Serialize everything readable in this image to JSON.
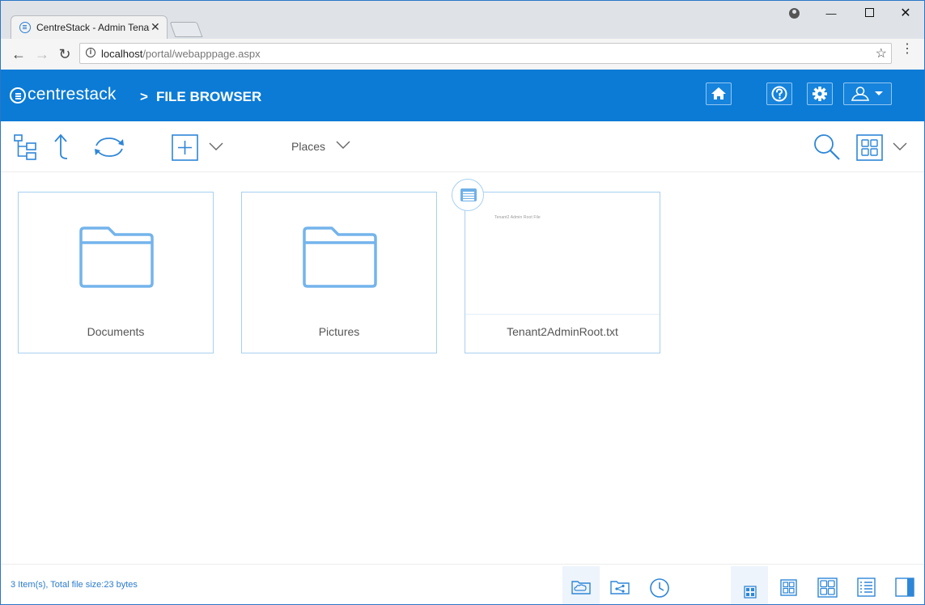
{
  "browser": {
    "tab_title": "CentreStack - Admin Tenant",
    "tab_close": "✕",
    "url_host": "localhost",
    "url_path": "/portal/webapppage.aspx",
    "info_glyph": "i",
    "star_glyph": "☆",
    "menu_glyph": "⋮",
    "back_glyph": "←",
    "forward_glyph": "→",
    "reload_glyph": "↻",
    "minimize_glyph": "—",
    "close_glyph": "✕"
  },
  "header": {
    "logo_text_light": "centre",
    "logo_text_bold": "stack",
    "breadcrumb_sep": ">",
    "breadcrumb_title": "FILE BROWSER",
    "icons": [
      "home-icon",
      "help-icon",
      "gear-icon",
      "user-icon",
      "caret-down-icon"
    ]
  },
  "toolbar": {
    "places_label": "Places",
    "icons": [
      "folder-tree-icon",
      "up-arrow-icon",
      "sync-icon",
      "add-icon",
      "chevron-down-icon",
      "search-icon",
      "grid-view-icon",
      "chevron-down-icon"
    ]
  },
  "files": [
    {
      "name": "Documents",
      "type": "folder"
    },
    {
      "name": "Pictures",
      "type": "folder"
    },
    {
      "name": "Tenant2AdminRoot.txt",
      "type": "file",
      "preview_text": "Tenant2 Admin Root File"
    }
  ],
  "status": {
    "summary": "3 Item(s), Total file size:23 bytes"
  },
  "statusbar_icons": [
    "cloud-folder-icon",
    "shared-folder-icon",
    "clock-icon",
    "small-tiles-icon",
    "medium-tiles-icon",
    "large-tiles-icon",
    "list-view-icon",
    "preview-pane-icon"
  ],
  "colors": {
    "accent": "#0b7bd6",
    "icon_blue": "#2e86d8",
    "tile_border": "#a8d0f0",
    "status_text": "#2b7bcc"
  }
}
